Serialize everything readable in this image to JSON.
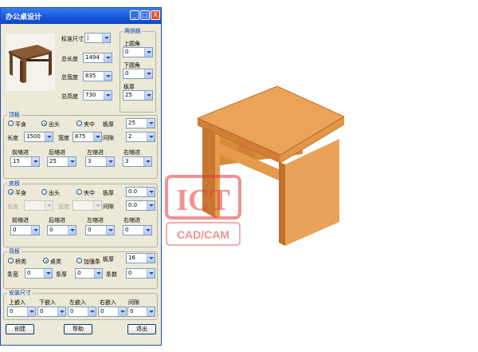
{
  "window": {
    "title": "办公桌设计",
    "controls": {
      "minimize": "_",
      "maximize": "□",
      "close": "X"
    }
  },
  "dims": {
    "std_size_label": "标准尺寸",
    "std_size_value": "|",
    "length_label": "总长度",
    "length_value": "1494",
    "width_label": "总宽度",
    "width_value": "835",
    "height_label": "总高度",
    "height_value": "730"
  },
  "sides": {
    "title": "两侧板",
    "upper_radius_label": "上圆角",
    "upper_radius_value": "0",
    "lower_radius_label": "下圆角",
    "lower_radius_value": "0",
    "thickness_label": "板厚",
    "thickness_value": "25"
  },
  "top": {
    "title": "顶板",
    "radios": [
      "平身",
      "出头",
      "夹中"
    ],
    "selected": 1,
    "thickness_label": "板厚",
    "thickness_value": "25",
    "length_label": "长度",
    "length_value": "1500",
    "width_label": "宽度",
    "width_value": "875",
    "gap_label": "间隙",
    "gap_value": "2",
    "front_label": "前缩进",
    "front_value": "15",
    "back_label": "后缩进",
    "back_value": "25",
    "left_label": "左缩进",
    "left_value": "3",
    "right_label": "右缩进",
    "right_value": "3"
  },
  "bottom": {
    "title": "底板",
    "radios": [
      "平身",
      "出头",
      "夹中"
    ],
    "selected": 0,
    "thickness_label": "板厚",
    "thickness_value": "0.0",
    "length_label": "长度",
    "length_value": "",
    "width_label": "宽度",
    "width_value": "",
    "gap_label": "间隙",
    "gap_value": "0.0",
    "front_label": "前缩进",
    "front_value": "0",
    "back_label": "后缩进",
    "back_value": "0",
    "left_label": "左缩进",
    "left_value": "0",
    "right_label": "右缩进",
    "right_value": "0"
  },
  "back": {
    "title": "背板",
    "radios": [
      "桥类",
      "桌类",
      "加强条"
    ],
    "selected": 1,
    "thickness_label": "板厚",
    "thickness_value": "16",
    "bar_width_label": "条宽",
    "bar_width_value": "0",
    "bar_thick_label": "条厚",
    "bar_thick_value": "0",
    "count_label": "条数",
    "count_value": "0"
  },
  "install": {
    "title": "安装尺寸",
    "labels": [
      "上嵌入",
      "下嵌入",
      "左嵌入",
      "右嵌入",
      "间隙"
    ],
    "values": [
      "0",
      "0",
      "0",
      "0",
      "0"
    ]
  },
  "buttons": {
    "create": "创建",
    "help": "帮助",
    "exit": "退出"
  },
  "watermark": {
    "big": "ICT",
    "small": "CAD/CAM"
  },
  "colors": {
    "title_bar": "#1656d9",
    "group_label": "#003aa8",
    "wood": "#e79a45",
    "watermark": "#e23b3b"
  }
}
